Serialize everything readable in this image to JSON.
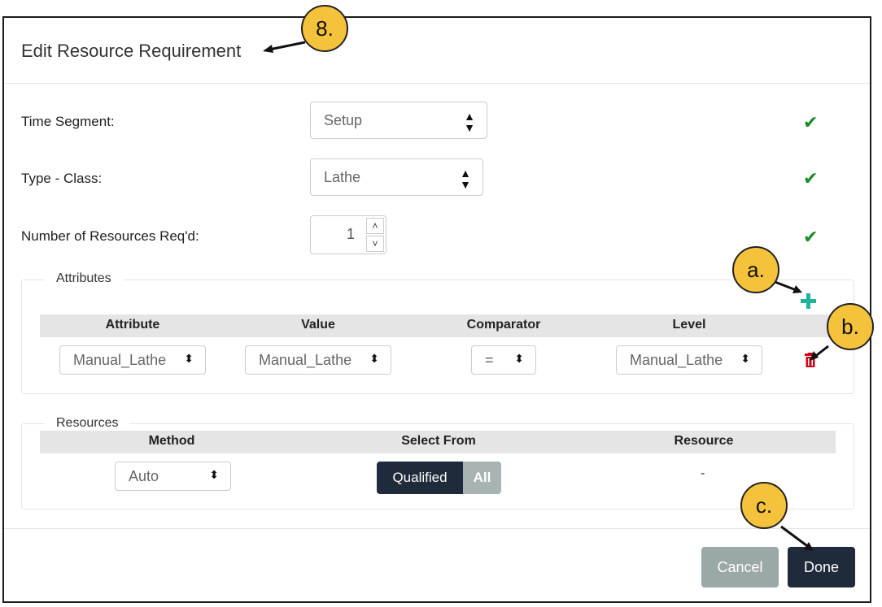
{
  "dialog": {
    "title": "Edit Resource Requirement"
  },
  "form": {
    "time_segment": {
      "label": "Time Segment:",
      "value": "Setup"
    },
    "type_class": {
      "label": "Type - Class:",
      "value": "Lathe"
    },
    "num_resources": {
      "label": "Number of Resources Req'd:",
      "value": "1"
    }
  },
  "attributes": {
    "legend": "Attributes",
    "columns": [
      "Attribute",
      "Value",
      "Comparator",
      "Level"
    ],
    "row": {
      "attribute": "Manual_Lathe",
      "value": "Manual_Lathe",
      "comparator": "=",
      "level": "Manual_Lathe"
    }
  },
  "resources": {
    "legend": "Resources",
    "columns": [
      "Method",
      "Select From",
      "Resource"
    ],
    "method": "Auto",
    "select_from_options": [
      "Qualified",
      "All"
    ],
    "select_from_active": "Qualified",
    "resource": "-"
  },
  "buttons": {
    "cancel": "Cancel",
    "done": "Done"
  },
  "callouts": {
    "title": "8.",
    "add": "a.",
    "delete": "b.",
    "done": "c."
  },
  "colors": {
    "callout": "#f5c33b",
    "check": "#1a8a2a",
    "plus": "#1fb59a",
    "trash": "#d0021b",
    "dark_button": "#1f2a3a",
    "muted_button": "#9aa8a8"
  },
  "icons": [
    "sort-arrows-icon",
    "check-icon",
    "plus-icon",
    "trash-icon",
    "chevron-up-icon",
    "chevron-down-icon"
  ]
}
